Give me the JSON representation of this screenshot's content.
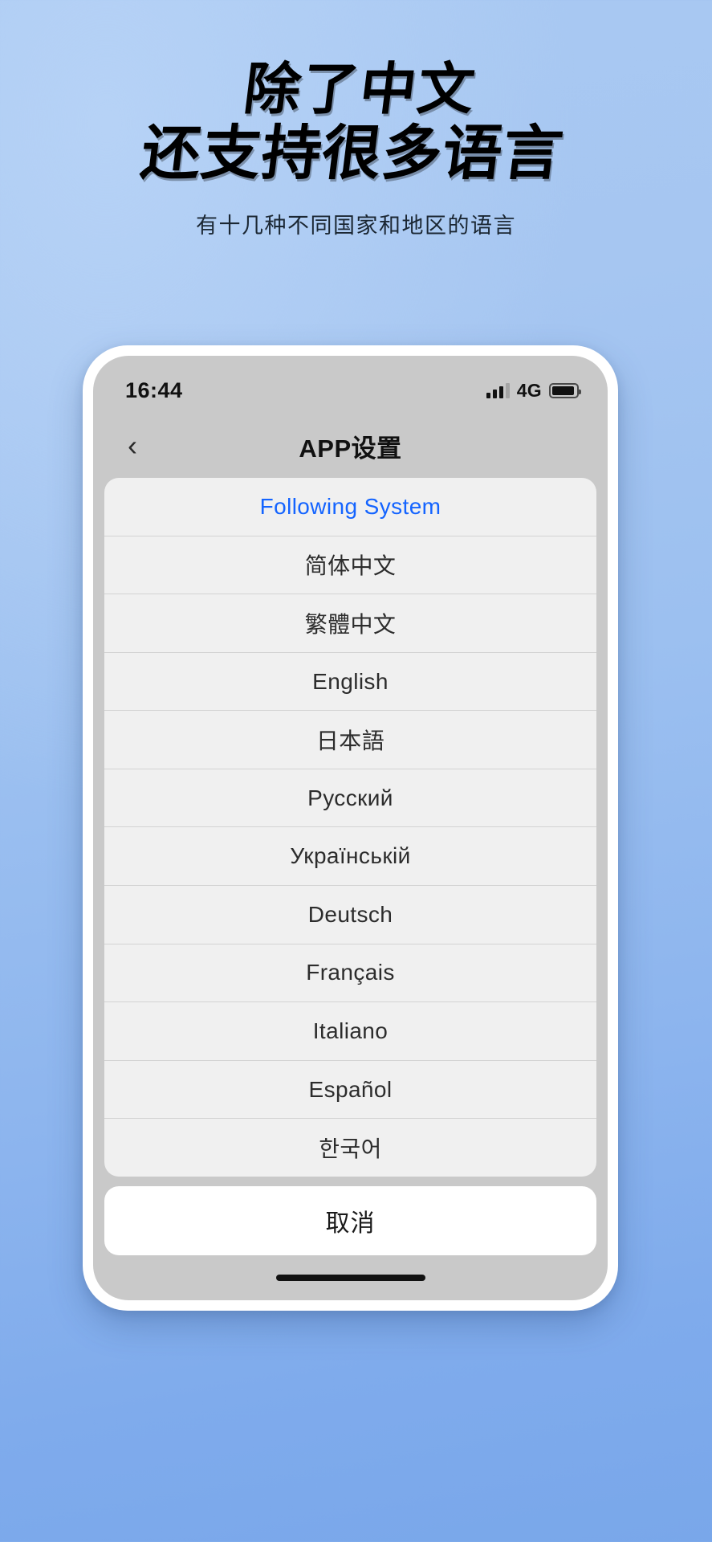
{
  "promo": {
    "headline_line1": "除了中文",
    "headline_line2": "还支持很多语言",
    "subhead": "有十几种不同国家和地区的语言"
  },
  "phone": {
    "status_bar": {
      "time": "16:44",
      "network": "4G",
      "signal_icon": "signal-bars-icon",
      "battery_icon": "battery-icon"
    },
    "nav_bar": {
      "back_icon": "chevron-left-icon",
      "title": "APP设置"
    },
    "action_sheet": {
      "options": [
        {
          "label": "Following System",
          "accent": true
        },
        {
          "label": "简体中文",
          "accent": false
        },
        {
          "label": "繁體中文",
          "accent": false
        },
        {
          "label": "English",
          "accent": false
        },
        {
          "label": "日本語",
          "accent": false
        },
        {
          "label": "Русский",
          "accent": false
        },
        {
          "label": "Українській",
          "accent": false
        },
        {
          "label": "Deutsch",
          "accent": false
        },
        {
          "label": "Français",
          "accent": false
        },
        {
          "label": "Italiano",
          "accent": false
        },
        {
          "label": "Español",
          "accent": false
        },
        {
          "label": "한국어",
          "accent": false
        }
      ],
      "cancel_label": "取消"
    },
    "home_indicator": "home-indicator"
  },
  "colors": {
    "accent_blue": "#1464ff",
    "background_top": "#a9c9f2",
    "background_bottom": "#79a7ea",
    "screen_gray": "#c9c9c9",
    "sheet_gray": "#f0f0f0"
  }
}
